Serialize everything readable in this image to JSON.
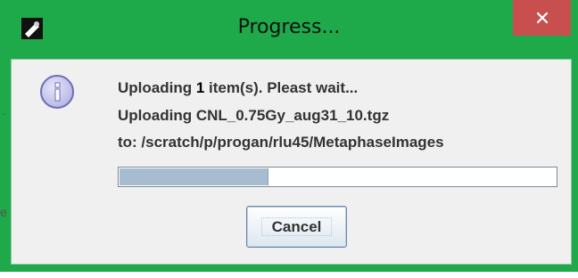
{
  "window": {
    "title": "Progress...",
    "close_glyph": "✕",
    "title_bar_color": "#1ea94a",
    "close_button_color": "#c7504f"
  },
  "message": {
    "line1_prefix": "Uploading ",
    "line1_count": "1",
    "line1_suffix": " item(s). Pleast wait...",
    "line2": "Uploading CNL_0.75Gy_aug31_10.tgz",
    "line3": "to: /scratch/p/progan/rlu45/MetaphaseImages",
    "info_icon": "information-icon"
  },
  "progress": {
    "fraction": 0.34
  },
  "buttons": {
    "cancel_label": "Cancel"
  },
  "background_edges": {
    "glyph1": ".",
    "glyph2": "e"
  }
}
